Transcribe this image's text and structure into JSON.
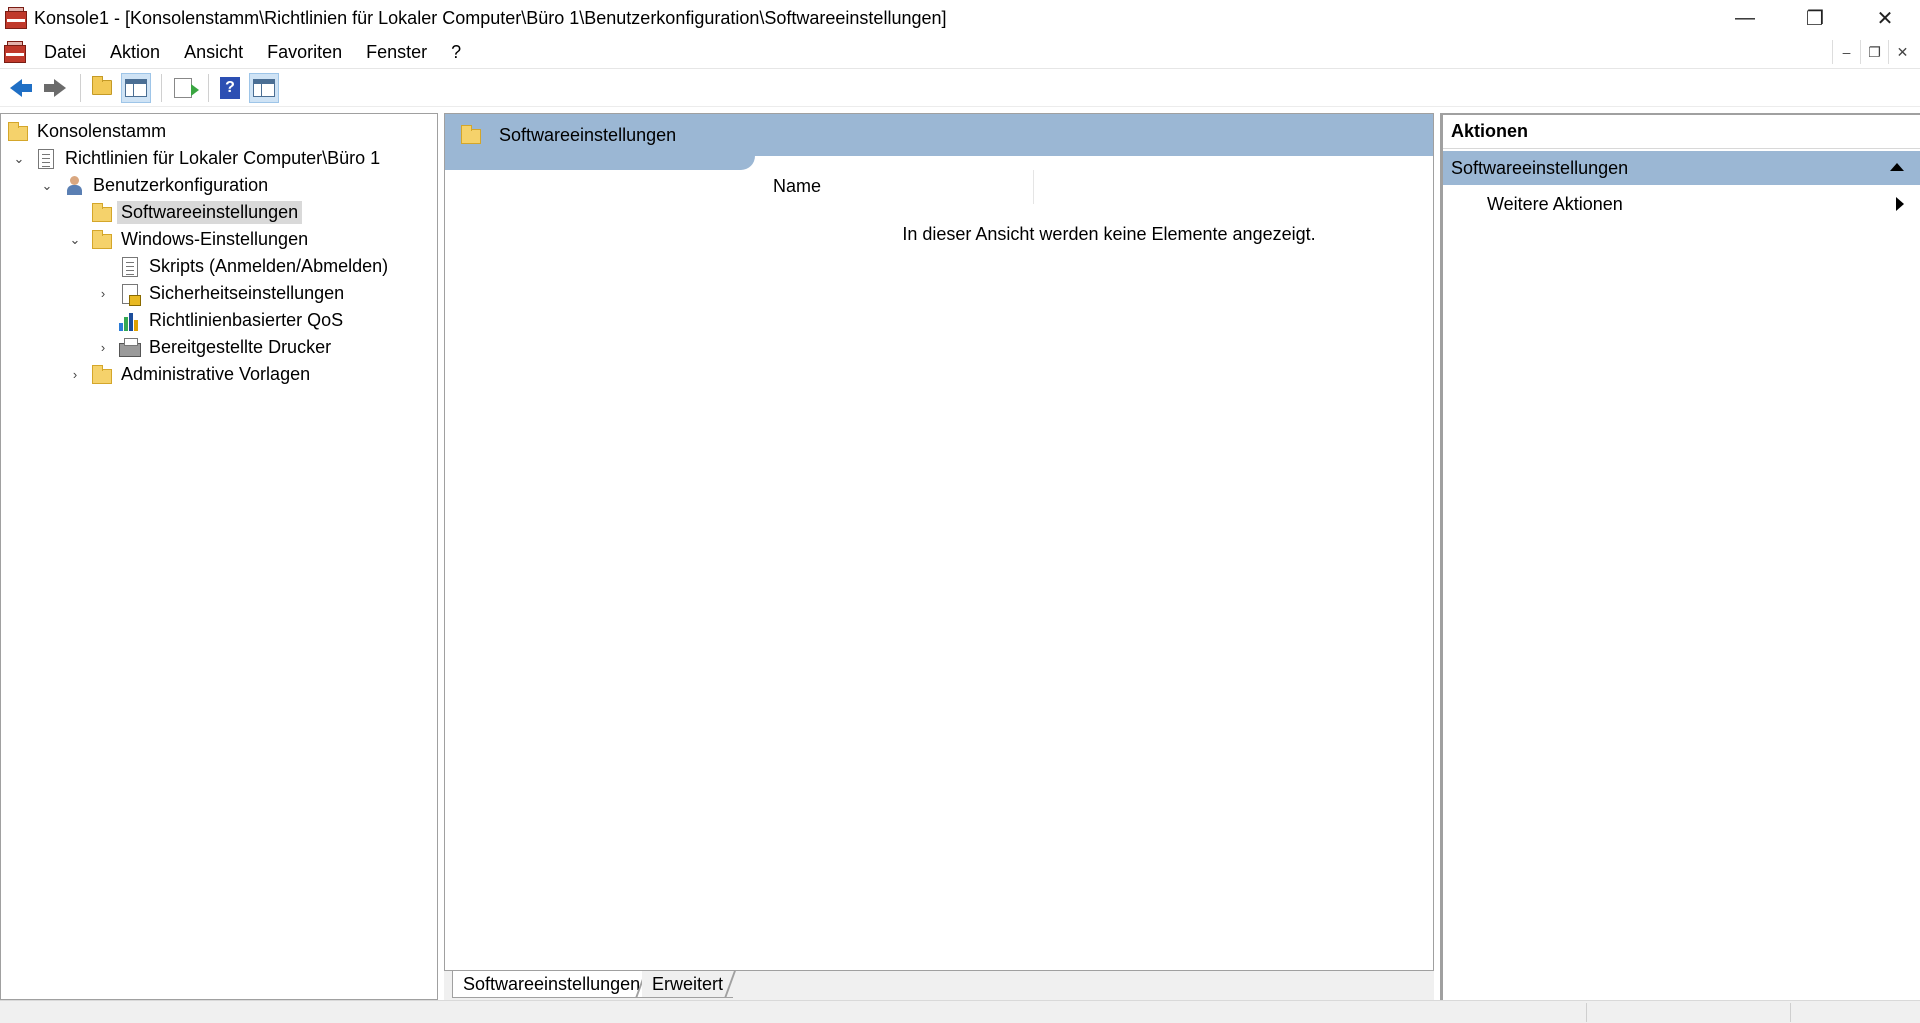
{
  "window": {
    "title": "Konsole1 - [Konsolenstamm\\Richtlinien für Lokaler Computer\\Büro 1\\Benutzerkonfiguration\\Softwareeinstellungen]",
    "minimize_glyph": "—",
    "restore_glyph": "❐",
    "close_glyph": "✕"
  },
  "menu": {
    "items": [
      "Datei",
      "Aktion",
      "Ansicht",
      "Favoriten",
      "Fenster",
      "?"
    ],
    "mdi_minimize": "–",
    "mdi_restore": "❐",
    "mdi_close": "✕"
  },
  "toolbar": {
    "buttons": [
      "back-icon",
      "forward-icon",
      "up-folder-icon",
      "show-hide-tree-icon",
      "export-list-icon",
      "help-icon",
      "show-hide-action-pane-icon"
    ]
  },
  "tree": {
    "items": [
      {
        "label": "Konsolenstamm",
        "icon": "folder-icon",
        "expander": ""
      },
      {
        "label": "Richtlinien für Lokaler Computer\\Büro 1",
        "icon": "policy-document-icon",
        "expander": "⌄"
      },
      {
        "label": "Benutzerkonfiguration",
        "icon": "user-config-icon",
        "expander": "⌄"
      },
      {
        "label": "Softwareeinstellungen",
        "icon": "folder-icon",
        "expander": ""
      },
      {
        "label": "Windows-Einstellungen",
        "icon": "folder-icon",
        "expander": "⌄"
      },
      {
        "label": "Skripts (Anmelden/Abmelden)",
        "icon": "script-icon",
        "expander": ""
      },
      {
        "label": "Sicherheitseinstellungen",
        "icon": "security-icon",
        "expander": "›"
      },
      {
        "label": "Richtlinienbasierter QoS",
        "icon": "qos-chart-icon",
        "expander": ""
      },
      {
        "label": "Bereitgestellte Drucker",
        "icon": "printer-icon",
        "expander": "›"
      },
      {
        "label": "Administrative Vorlagen",
        "icon": "folder-icon",
        "expander": "›"
      }
    ],
    "selected": "Softwareeinstellungen"
  },
  "result": {
    "header_title": "Softwareeinstellungen",
    "column_name": "Name",
    "empty_message": "In dieser Ansicht werden keine Elemente angezeigt."
  },
  "tabs": {
    "active": "Softwareeinstellungen",
    "inactive": "Erweitert"
  },
  "actions": {
    "header": "Aktionen",
    "section": "Softwareeinstellungen",
    "item": "Weitere Aktionen"
  },
  "colors": {
    "header_blue": "#9bb7d4",
    "folder_yellow": "#f5d26b",
    "selection_gray": "#d9d9d9"
  }
}
